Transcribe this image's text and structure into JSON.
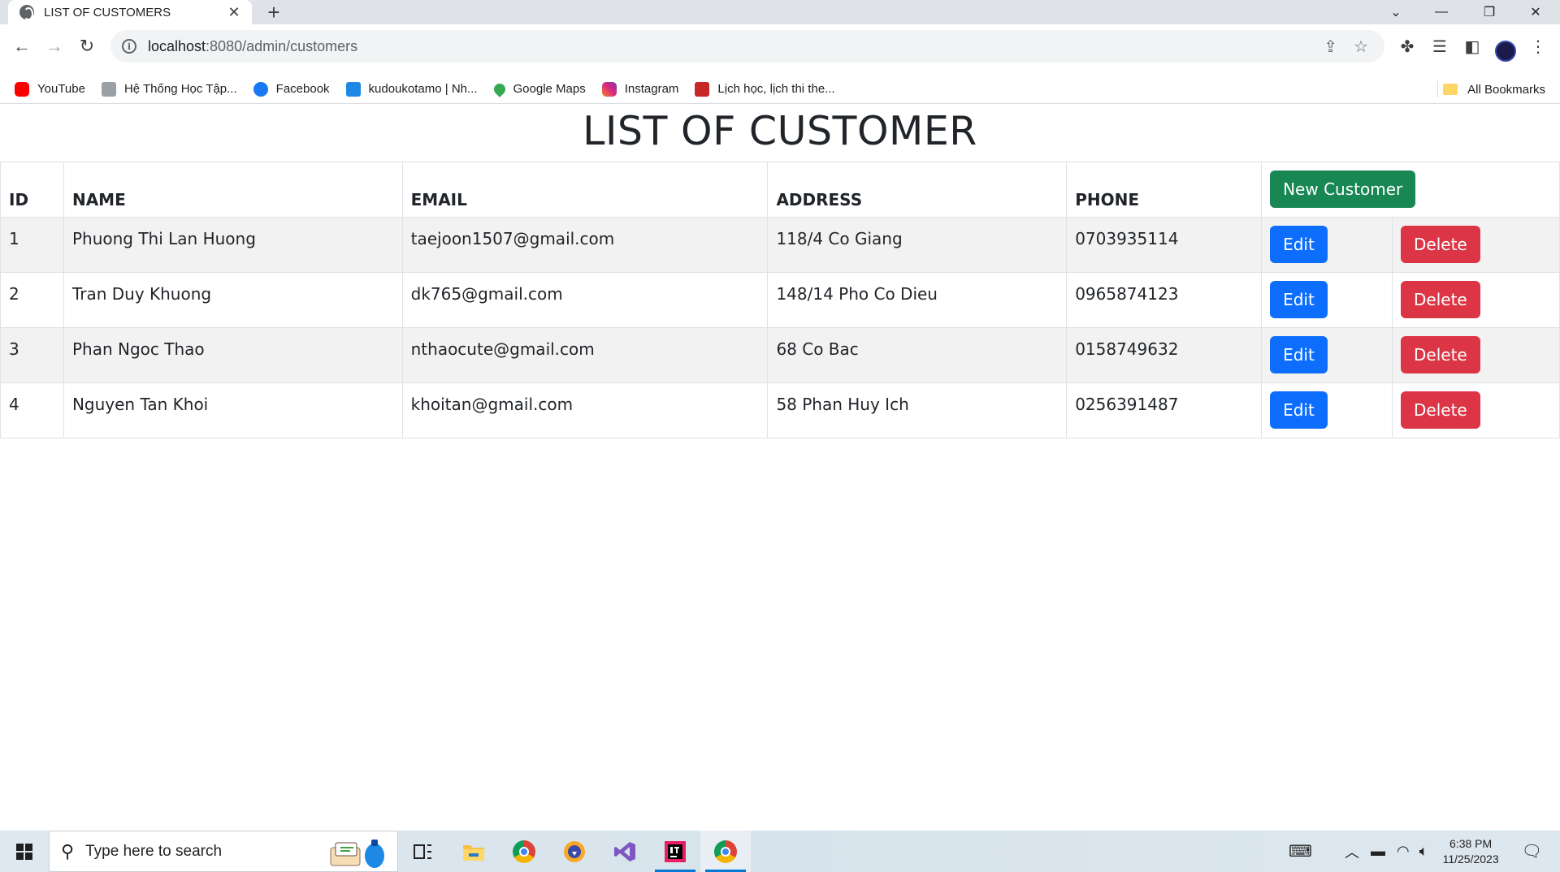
{
  "browser": {
    "tab_title": "LIST OF CUSTOMERS",
    "tab_close": "✕",
    "new_tab": "+",
    "url_host": "localhost",
    "url_path": ":8080/admin/customers",
    "win_controls": {
      "dropdown": "⌄",
      "minimize": "—",
      "restore": "❐",
      "close": "✕"
    },
    "bookmarks": [
      {
        "label": "YouTube",
        "icon": "youtube-icon",
        "color": "#ff0000"
      },
      {
        "label": "Hệ Thống Học Tập...",
        "icon": "school-icon",
        "color": "#9aa0a6"
      },
      {
        "label": "Facebook",
        "icon": "facebook-icon",
        "color": "#1877f2"
      },
      {
        "label": "kudoukotamo | Nh...",
        "icon": "camera-icon",
        "color": "#1e88e5"
      },
      {
        "label": "Google Maps",
        "icon": "map-pin-icon",
        "color": "#34a853"
      },
      {
        "label": "Instagram",
        "icon": "instagram-icon",
        "color": "#e1306c"
      },
      {
        "label": "Lịch học, lịch thi the...",
        "icon": "university-icon",
        "color": "#c62828"
      }
    ],
    "all_bookmarks": "All Bookmarks"
  },
  "page": {
    "heading": "LIST OF CUSTOMER",
    "columns": [
      "ID",
      "NAME",
      "EMAIL",
      "ADDRESS",
      "PHONE"
    ],
    "new_customer_label": "New Customer",
    "edit_label": "Edit",
    "delete_label": "Delete",
    "customers": [
      {
        "id": "1",
        "name": "Phuong Thi Lan Huong",
        "email": "taejoon1507@gmail.com",
        "address": "118/4 Co Giang",
        "phone": "0703935114"
      },
      {
        "id": "2",
        "name": "Tran Duy Khuong",
        "email": "dk765@gmail.com",
        "address": "148/14 Pho Co Dieu",
        "phone": "0965874123"
      },
      {
        "id": "3",
        "name": "Phan Ngoc Thao",
        "email": "nthaocute@gmail.com",
        "address": "68 Co Bac",
        "phone": "0158749632"
      },
      {
        "id": "4",
        "name": "Nguyen Tan Khoi",
        "email": "khoitan@gmail.com",
        "address": "58 Phan Huy Ich",
        "phone": "0256391487"
      }
    ]
  },
  "taskbar": {
    "search_placeholder": "Type here to search",
    "time": "6:38 PM",
    "date": "11/25/2023"
  },
  "colors": {
    "success": "#198754",
    "primary": "#0d6efd",
    "danger": "#dc3545"
  }
}
